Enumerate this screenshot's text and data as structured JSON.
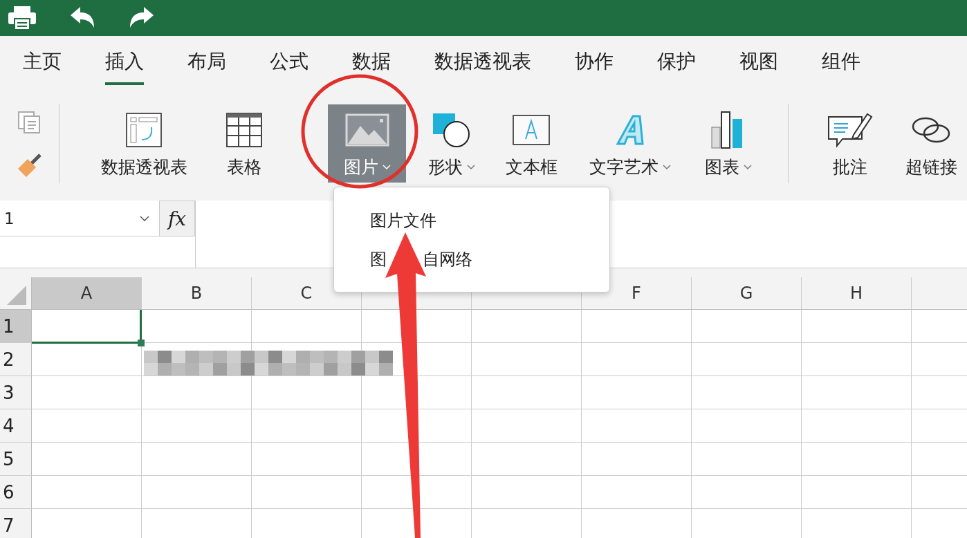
{
  "tabs": [
    {
      "label": "主页",
      "selected": false
    },
    {
      "label": "插入",
      "selected": true
    },
    {
      "label": "布局",
      "selected": false
    },
    {
      "label": "公式",
      "selected": false
    },
    {
      "label": "数据",
      "selected": false
    },
    {
      "label": "数据透视表",
      "selected": false
    },
    {
      "label": "协作",
      "selected": false
    },
    {
      "label": "保护",
      "selected": false
    },
    {
      "label": "视图",
      "selected": false
    },
    {
      "label": "组件",
      "selected": false
    }
  ],
  "ribbon": [
    {
      "label": "数据透视表",
      "dropdown": false,
      "selected": false
    },
    {
      "label": "表格",
      "dropdown": false,
      "selected": false
    },
    {
      "label": "图片",
      "dropdown": true,
      "selected": true
    },
    {
      "label": "形状",
      "dropdown": true,
      "selected": false
    },
    {
      "label": "文本框",
      "dropdown": false,
      "selected": false
    },
    {
      "label": "文字艺术",
      "dropdown": true,
      "selected": false
    },
    {
      "label": "图表",
      "dropdown": true,
      "selected": false
    },
    {
      "label": "批注",
      "dropdown": false,
      "selected": false
    },
    {
      "label": "超链接",
      "dropdown": false,
      "selected": false
    }
  ],
  "name_box": {
    "value": "1"
  },
  "fx_label": "fx",
  "columns": [
    {
      "label": "A",
      "selected": true
    },
    {
      "label": "B",
      "selected": false
    },
    {
      "label": "C",
      "selected": false
    },
    {
      "selected": false
    },
    {
      "selected": false
    },
    {
      "label": "F",
      "selected": false
    },
    {
      "label": "G",
      "selected": false
    },
    {
      "label": "H",
      "selected": false
    },
    {
      "selected": false
    }
  ],
  "rows": [
    {
      "label": "1",
      "selected": true
    },
    {
      "label": "2",
      "selected": false
    },
    {
      "label": "3",
      "selected": false
    },
    {
      "label": "4",
      "selected": false
    },
    {
      "label": "5",
      "selected": false
    },
    {
      "label": "6",
      "selected": false
    },
    {
      "label": "7",
      "selected": false
    }
  ],
  "picture_menu": {
    "items": [
      {
        "parts": [
          "图片文件"
        ]
      },
      {
        "parts": [
          "图",
          "自网络"
        ]
      }
    ]
  }
}
